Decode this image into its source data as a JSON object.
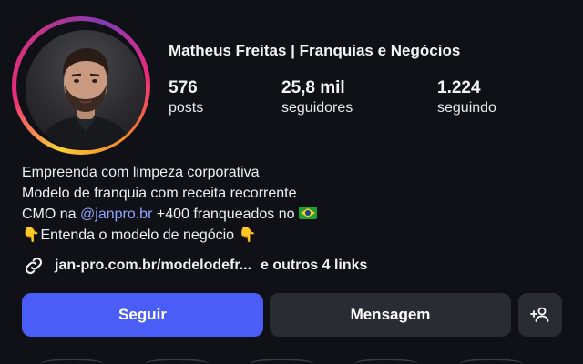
{
  "profile": {
    "name": "Matheus Freitas | Franquias e Negócios",
    "avatar_icon": "profile-photo",
    "story_ring_colors": [
      "#f9ce34",
      "#ee2a7b",
      "#833ab4"
    ]
  },
  "stats": [
    {
      "value": "576",
      "label": "posts"
    },
    {
      "value": "25,8 mil",
      "label": "seguidores"
    },
    {
      "value": "1.224",
      "label": "seguindo"
    }
  ],
  "bio": {
    "line1": "Empreenda com limpeza corporativa",
    "line2": "Modelo de franquia com receita recorrente",
    "line3_prefix": "CMO na ",
    "line3_mention": "@janpro.br",
    "line3_suffix": " +400 franqueados no",
    "line3_flag_icon": "brazil-flag-emoji",
    "line4_text": "Entenda o modelo de negócio",
    "line4_emoji_icon": "pointing-down-emoji"
  },
  "links": {
    "icon": "link-icon",
    "url_text": "jan-pro.com.br/modelodefr...",
    "more_text": "e outros 4 links"
  },
  "actions": {
    "follow_label": "Seguir",
    "message_label": "Mensagem",
    "add_icon": "add-person-icon"
  },
  "colors": {
    "background": "#101116",
    "follow_button": "#4a5ef7",
    "secondary_button": "#2a2c33",
    "mention": "#8fa6ff"
  }
}
